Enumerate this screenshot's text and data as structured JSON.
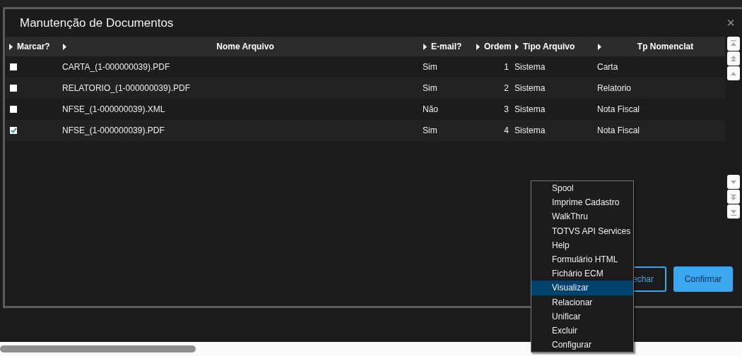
{
  "dialog": {
    "title": "Manutenção de Documentos",
    "close": "×"
  },
  "table": {
    "columns": [
      "Marcar?",
      "Nome Arquivo",
      "E-mail?",
      "Ordem",
      "Tipo Arquivo",
      "Tp Nomenclat"
    ],
    "rows": [
      {
        "checked": false,
        "name": "CARTA_(1-000000039).PDF",
        "email": "Sim",
        "order": "1",
        "type": "Sistema",
        "nomenclature": "Carta"
      },
      {
        "checked": false,
        "name": "RELATORIO_(1-000000039).PDF",
        "email": "Sim",
        "order": "2",
        "type": "Sistema",
        "nomenclature": "Relatorio"
      },
      {
        "checked": false,
        "name": "NFSE_(1-000000039).XML",
        "email": "Não",
        "order": "3",
        "type": "Sistema",
        "nomenclature": "Nota Fiscal"
      },
      {
        "checked": true,
        "name": "NFSE_(1-000000039).PDF",
        "email": "Sim",
        "order": "4",
        "type": "Sistema",
        "nomenclature": "Nota Fiscal"
      }
    ]
  },
  "buttons": [
    {
      "label": "echar",
      "kind": "outline"
    },
    {
      "label": "Confirmar",
      "kind": "primary"
    }
  ],
  "context_menu": [
    {
      "label": "Spool",
      "selected": false
    },
    {
      "label": "Imprime Cadastro",
      "selected": false
    },
    {
      "label": "WalkThru",
      "selected": false
    },
    {
      "label": "TOTVS API Services",
      "selected": false
    },
    {
      "label": "Help",
      "selected": false
    },
    {
      "label": "Formulário HTML",
      "selected": false
    },
    {
      "label": "Fichário ECM",
      "selected": false
    },
    {
      "label": "Visualizar",
      "selected": true
    },
    {
      "label": "Relacionar",
      "selected": false
    },
    {
      "label": "Unificar",
      "selected": false
    },
    {
      "label": "Excluir",
      "selected": false
    },
    {
      "label": "Configurar",
      "selected": false
    }
  ]
}
